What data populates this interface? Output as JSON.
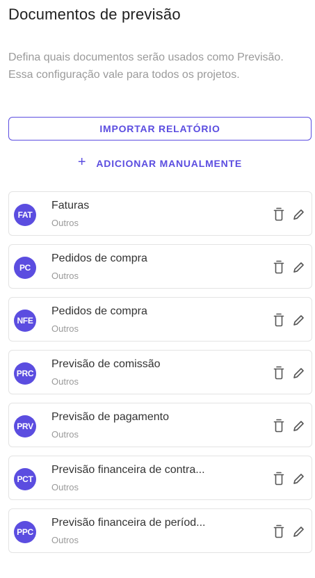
{
  "header": {
    "title": "Documentos de previsão",
    "description": "Defina quais documentos serão usados como Previsão. Essa configuração vale para todos os projetos."
  },
  "actions": {
    "import_label": "IMPORTAR RELATÓRIO",
    "add_label": "ADICIONAR MANUALMENTE",
    "add_icon": "plus-icon"
  },
  "colors": {
    "accent": "#5b4de0",
    "border": "#e3e3e3",
    "muted_text": "#9a9a9a"
  },
  "documents": [
    {
      "abbr": "FAT",
      "name": "Faturas",
      "category": "Outros"
    },
    {
      "abbr": "PC",
      "name": "Pedidos de compra",
      "category": "Outros"
    },
    {
      "abbr": "NFE",
      "name": "Pedidos de compra",
      "category": "Outros"
    },
    {
      "abbr": "PRC",
      "name": "Previsão de comissão",
      "category": "Outros"
    },
    {
      "abbr": "PRV",
      "name": "Previsão de pagamento",
      "category": "Outros"
    },
    {
      "abbr": "PCT",
      "name": "Previsão financeira de contra...",
      "category": "Outros"
    },
    {
      "abbr": "PPC",
      "name": "Previsão financeira de períod...",
      "category": "Outros"
    }
  ],
  "row_icons": {
    "delete": "trash-icon",
    "edit": "pencil-icon"
  }
}
